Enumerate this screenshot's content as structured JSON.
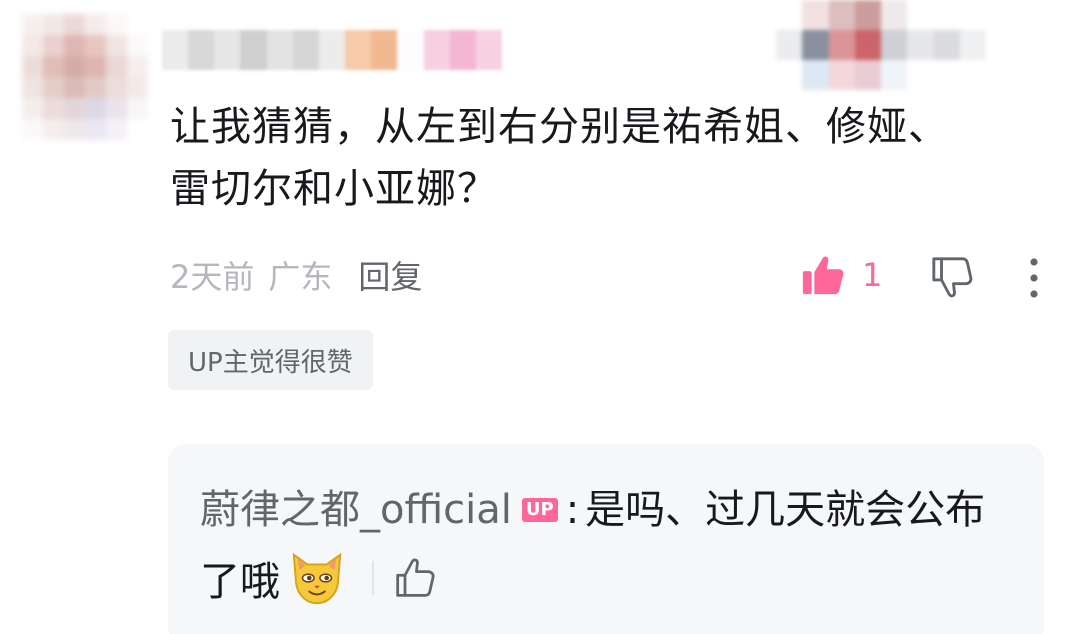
{
  "comment": {
    "text_line1": "让我猜猜，从左到右分别是祐希姐、修娅、",
    "text_line2": "雷切尔和小亚娜？",
    "time": "2天前",
    "location": "广东",
    "reply_label": "回复",
    "like_count": "1",
    "up_badge": "UP主觉得很赞"
  },
  "reply": {
    "author": "蔚律之都_official",
    "up_tag": "UP",
    "colon": ":",
    "text_line1": "是吗、过几天就会公布",
    "text_line2": "了哦"
  },
  "colors": {
    "like_pink": "#ff6699",
    "text_main": "#18191c",
    "text_muted": "#b4b7bd",
    "reply_bg": "#f6f7f8"
  },
  "icons": {
    "like": "thumb-up-filled-icon",
    "dislike": "thumb-down-outline-icon",
    "more": "vertical-dots-icon",
    "emoji": "cat-face-emoji",
    "reply_like": "thumb-up-outline-icon"
  }
}
